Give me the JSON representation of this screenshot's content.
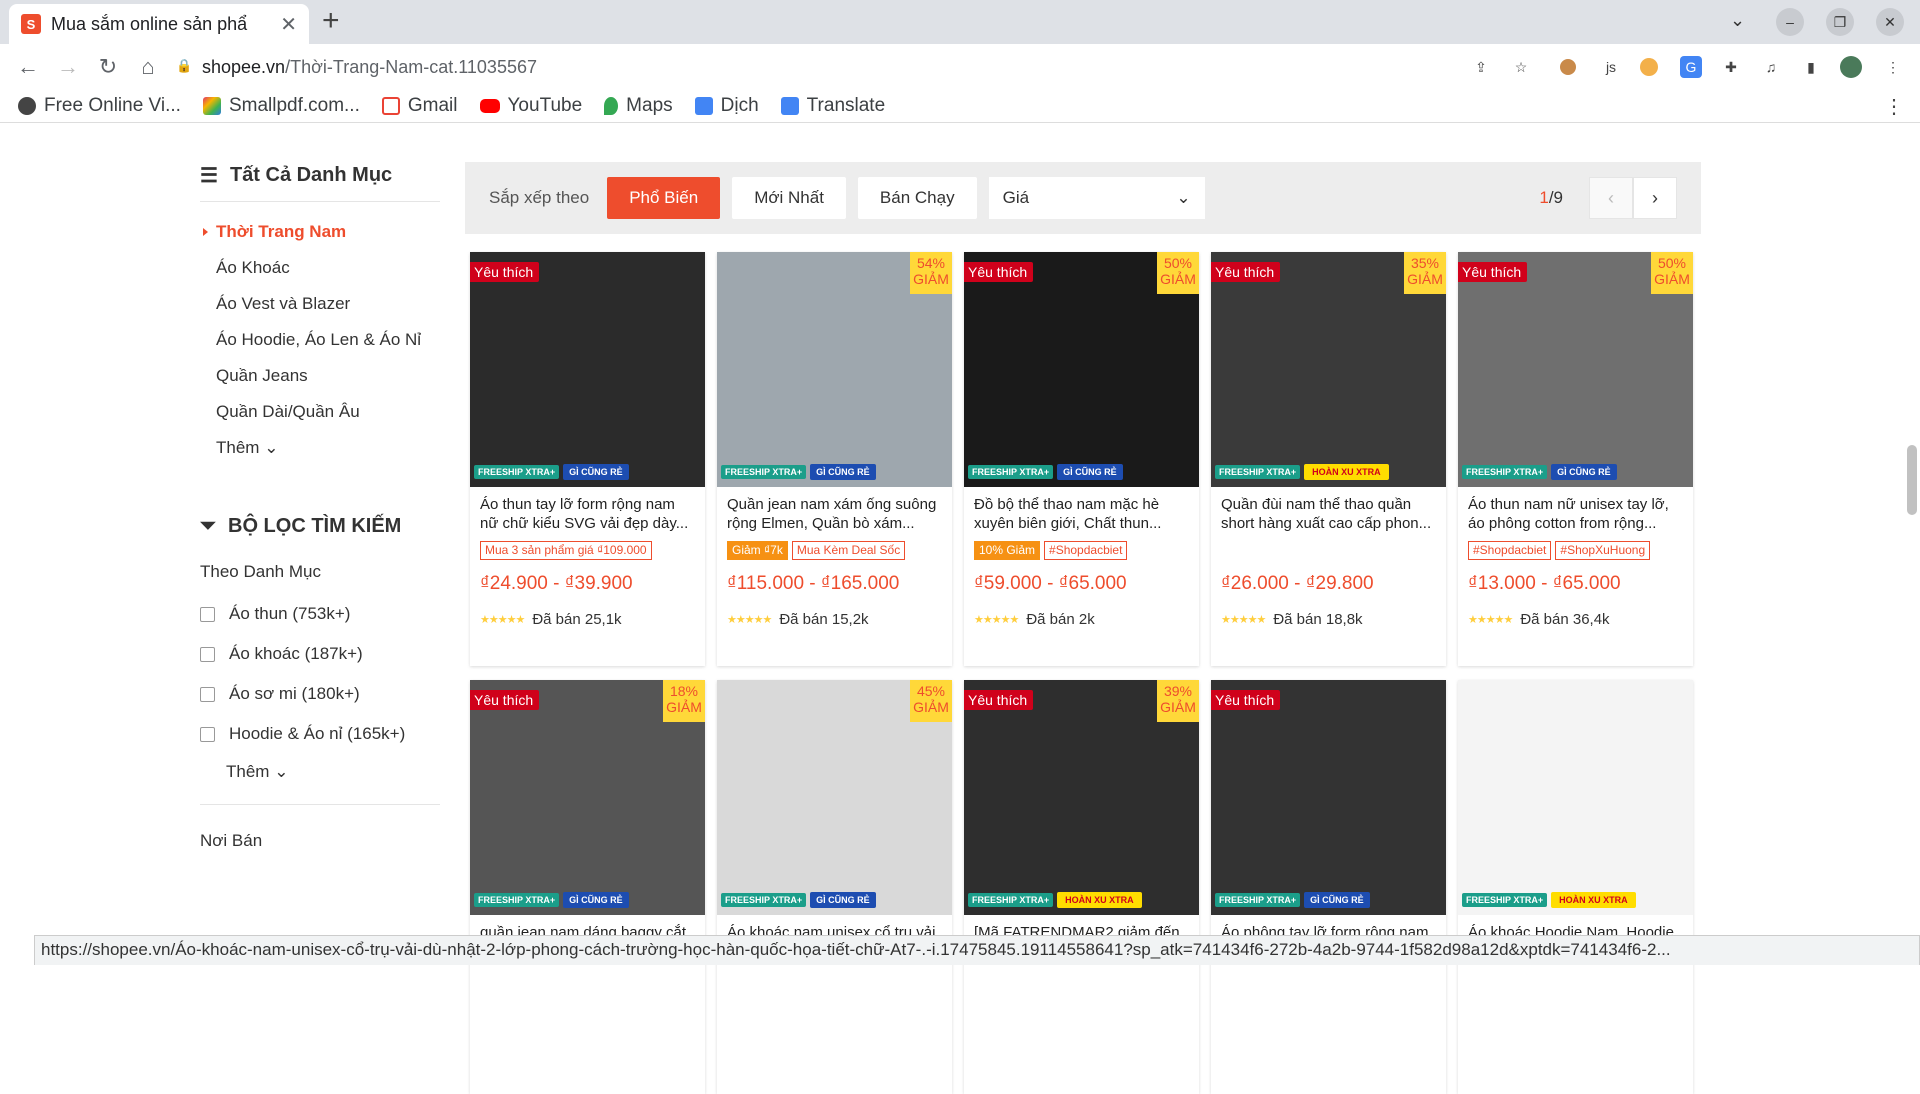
{
  "browser": {
    "tab_title": "Mua sắm online sản phẩ",
    "url_domain": "shopee.vn",
    "url_path": "/Thời-Trang-Nam-cat.11035567",
    "bookmarks": [
      {
        "label": "Free Online Vi...",
        "color": "#444"
      },
      {
        "label": "Smallpdf.com...",
        "color": "#e0336c"
      },
      {
        "label": "Gmail",
        "color": "#ea4335"
      },
      {
        "label": "YouTube",
        "color": "#ff0000"
      },
      {
        "label": "Maps",
        "color": "#34a853"
      },
      {
        "label": "Dịch",
        "color": "#4285f4"
      },
      {
        "label": "Translate",
        "color": "#4285f4"
      }
    ]
  },
  "sidebar": {
    "all_categories": "Tất Cả Danh Mục",
    "categories": [
      "Thời Trang Nam",
      "Áo Khoác",
      "Áo Vest và Blazer",
      "Áo Hoodie, Áo Len & Áo Nỉ",
      "Quần Jeans",
      "Quần Dài/Quần Âu"
    ],
    "more": "Thêm",
    "filter_title": "BỘ LỌC TÌM KIẾM",
    "by_category": "Theo Danh Mục",
    "filters": [
      "Áo thun (753k+)",
      "Áo khoác (187k+)",
      "Áo sơ mi (180k+)",
      "Hoodie & Áo nỉ (165k+)"
    ],
    "filter_more": "Thêm",
    "seller": "Nơi Bán"
  },
  "sortbar": {
    "label": "Sắp xếp theo",
    "popular": "Phổ Biến",
    "newest": "Mới Nhất",
    "bestselling": "Bán Chạy",
    "price": "Giá",
    "page_current": "1",
    "page_total": "/9"
  },
  "strip": {
    "freeship": "FREESHIP XTRA+",
    "gi": "GÌ CŨNG RẺ",
    "hoanxu": "HOÀN XU XTRA"
  },
  "products": [
    {
      "name": "Áo thun tay lỡ form rộng nam nữ chữ kiểu SVG vải đẹp dày...",
      "fav": "Yêu thích",
      "disc": "",
      "tags": [
        "Mua 3 sản phẩm giá ₫109.000"
      ],
      "price": "₫24.900 - ₫39.900",
      "sold": "Đã bán 25,1k",
      "img": "#2b2b2b"
    },
    {
      "name": "Quần jean nam xám ống suông rộng Elmen, Quần bò xám...",
      "fav": "",
      "disc": "54%",
      "tags": [
        "Giảm ₫7k",
        "Mua Kèm Deal Sốc"
      ],
      "price": "₫115.000 - ₫165.000",
      "sold": "Đã bán 15,2k",
      "img": "#9ea7ae"
    },
    {
      "name": "Đồ bộ thể thao nam mặc hè xuyên biên giới, Chất thun...",
      "fav": "Yêu thích",
      "disc": "50%",
      "tags": [
        "10% Giảm",
        "#Shopdacbiet"
      ],
      "price": "₫59.000 - ₫65.000",
      "sold": "Đã bán 2k",
      "img": "#1a1a1a"
    },
    {
      "name": "Quần đùi nam thể thao quần short hàng xuất cao cấp phon...",
      "fav": "Yêu thích",
      "disc": "35%",
      "tags": [],
      "price": "₫26.000 - ₫29.800",
      "sold": "Đã bán 18,8k",
      "img": "#3a3a3a"
    },
    {
      "name": "Áo thun nam nữ unisex tay lỡ, áo phông cotton from rộng...",
      "fav": "Yêu thích",
      "disc": "50%",
      "tags": [
        "#Shopdacbiet",
        "#ShopXuHuong"
      ],
      "price": "₫13.000 - ₫65.000",
      "sold": "Đã bán 36,4k",
      "img": "#6f6f6f"
    },
    {
      "name": "quần jean nam dáng baggy cắt",
      "fav": "Yêu thích",
      "disc": "18%",
      "tags": [],
      "price": "",
      "sold": "",
      "img": "#555"
    },
    {
      "name": "Áo khoác nam unisex cổ trụ vải",
      "fav": "",
      "disc": "45%",
      "tags": [],
      "price": "",
      "sold": "",
      "img": "#d9d9d9"
    },
    {
      "name": "[Mã FATRENDMAR2 giảm đến",
      "fav": "Yêu thích",
      "disc": "39%",
      "tags": [],
      "price": "",
      "sold": "",
      "img": "#2e2e2e"
    },
    {
      "name": "Áo phông tay lỡ form rộng nam",
      "fav": "Yêu thích",
      "disc": "",
      "tags": [],
      "price": "",
      "sold": "",
      "img": "#333"
    },
    {
      "name": "Áo khoác Hoodie Nam, Hoodie",
      "fav": "",
      "disc": "",
      "tags": [],
      "price": "",
      "sold": "",
      "img": "#f4f4f4"
    }
  ],
  "status_url": "https://shopee.vn/Áo-khoác-nam-unisex-cổ-trụ-vải-dù-nhật-2-lớp-phong-cách-trường-học-hàn-quốc-họa-tiết-chữ-At7-.-i.17475845.19114558641?sp_atk=741434f6-272b-4a2b-9744-1f582d98a12d&xptdk=741434f6-2..."
}
